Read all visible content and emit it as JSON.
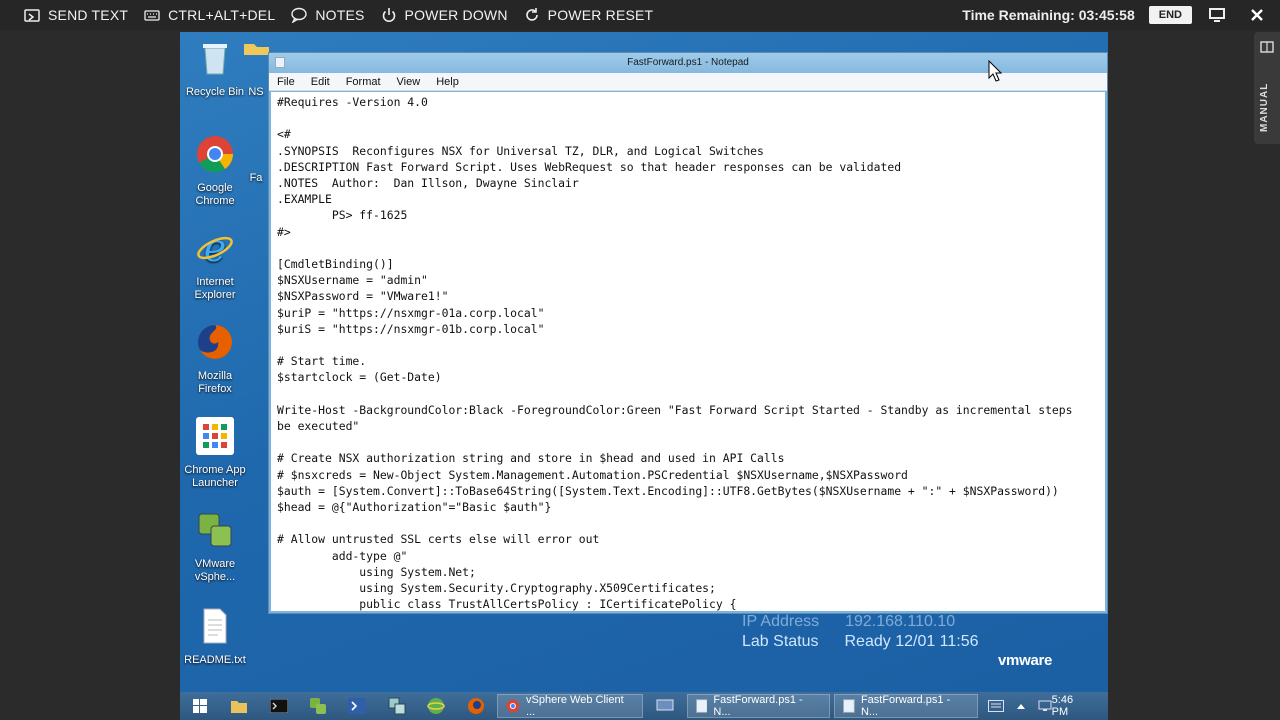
{
  "topbar": {
    "buttons": [
      {
        "label": "SEND TEXT",
        "icon": "keyboard-send-icon"
      },
      {
        "label": "CTRL+ALT+DEL",
        "icon": "keyboard-icon"
      },
      {
        "label": "NOTES",
        "icon": "speech-bubble-icon"
      },
      {
        "label": "POWER DOWN",
        "icon": "power-icon"
      },
      {
        "label": "POWER RESET",
        "icon": "refresh-icon"
      }
    ],
    "time_remaining": "Time Remaining: 03:45:58",
    "end_label": "END"
  },
  "manual_tab": {
    "label": "MANUAL"
  },
  "desktop": {
    "icons": [
      {
        "label": "Recycle Bin",
        "icon": "recycle-bin-icon"
      },
      {
        "label": "Google Chrome",
        "icon": "chrome-icon"
      },
      {
        "label": "Internet Explorer",
        "icon": "internet-explorer-icon"
      },
      {
        "label": "Mozilla Firefox",
        "icon": "firefox-icon"
      },
      {
        "label": "Chrome App Launcher",
        "icon": "app-launcher-icon"
      },
      {
        "label": "VMware vSphe...",
        "icon": "vsphere-icon"
      },
      {
        "label": "README.txt",
        "icon": "text-file-icon"
      }
    ],
    "partial_labels": [
      "NS",
      "Fa"
    ],
    "lab": {
      "ip_label": "IP Address",
      "ip_value": "192.168.110.10",
      "status_label": "Lab Status",
      "status_value": "Ready 12/01 11:56"
    },
    "brand": "vmware"
  },
  "notepad": {
    "title": "FastForward.ps1 - Notepad",
    "menu": [
      "File",
      "Edit",
      "Format",
      "View",
      "Help"
    ],
    "content": "#Requires -Version 4.0\n\n<#\n.SYNOPSIS  Reconfigures NSX for Universal TZ, DLR, and Logical Switches\n.DESCRIPTION Fast Forward Script. Uses WebRequest so that header responses can be validated\n.NOTES  Author:  Dan Illson, Dwayne Sinclair\n.EXAMPLE\n        PS> ff-1625\n#>\n\n[CmdletBinding()]\n$NSXUsername = \"admin\"\n$NSXPassword = \"VMware1!\"\n$uriP = \"https://nsxmgr-01a.corp.local\"\n$uriS = \"https://nsxmgr-01b.corp.local\"\n\n# Start time.\n$startclock = (Get-Date)\n\nWrite-Host -BackgroundColor:Black -ForegroundColor:Green \"Fast Forward Script Started - Standby as incremental steps\nbe executed\"\n\n# Create NSX authorization string and store in $head and used in API Calls\n# $nsxcreds = New-Object System.Management.Automation.PSCredential $NSXUsername,$NSXPassword\n$auth = [System.Convert]::ToBase64String([System.Text.Encoding]::UTF8.GetBytes($NSXUsername + \":\" + $NSXPassword))\n$head = @{\"Authorization\"=\"Basic $auth\"}\n\n# Allow untrusted SSL certs else will error out\n        add-type @\"\n            using System.Net;\n            using System.Security.Cryptography.X509Certificates;\n            public class TrustAllCertsPolicy : ICertificatePolicy {"
  },
  "taskbar": {
    "apps": [
      "vSphere Web Client ...",
      "FastForward.ps1 - N...",
      "FastForward.ps1 - N..."
    ],
    "clock": "5:46 PM"
  }
}
